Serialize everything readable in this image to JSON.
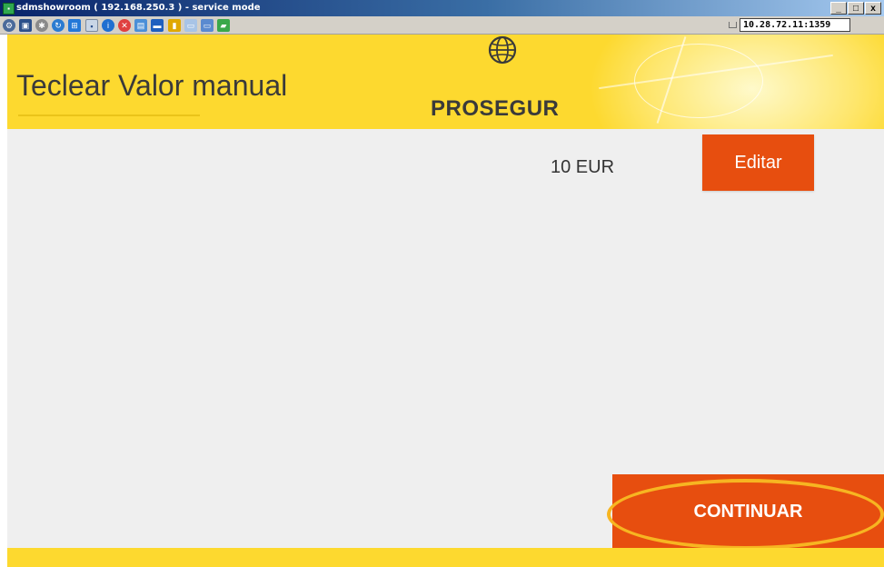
{
  "window": {
    "title": "sdmshowroom ( 192.168.250.3 ) - service mode",
    "minimize": "_",
    "maximize": "□",
    "close": "x"
  },
  "toolbar": {
    "icons": [
      "link-icon",
      "capture-icon",
      "settings-icon",
      "refresh-icon",
      "windows-icon",
      "screen-icon",
      "info-icon",
      "stop-icon",
      "clipboard-icon",
      "monitor-icon",
      "folder-icon",
      "desktop-icon",
      "display-icon",
      "chat-icon"
    ],
    "host": "10.28.72.11:1359"
  },
  "header": {
    "title": "Teclear Valor manual",
    "logo_text": "PROSEGUR"
  },
  "main": {
    "amount": "10 EUR",
    "edit_label": "Editar",
    "continue_label": "CONTINUAR"
  },
  "colors": {
    "brand_yellow": "#fdd92f",
    "action_orange": "#e74e0f",
    "highlight": "#f7b521",
    "content_bg": "#efefef"
  }
}
